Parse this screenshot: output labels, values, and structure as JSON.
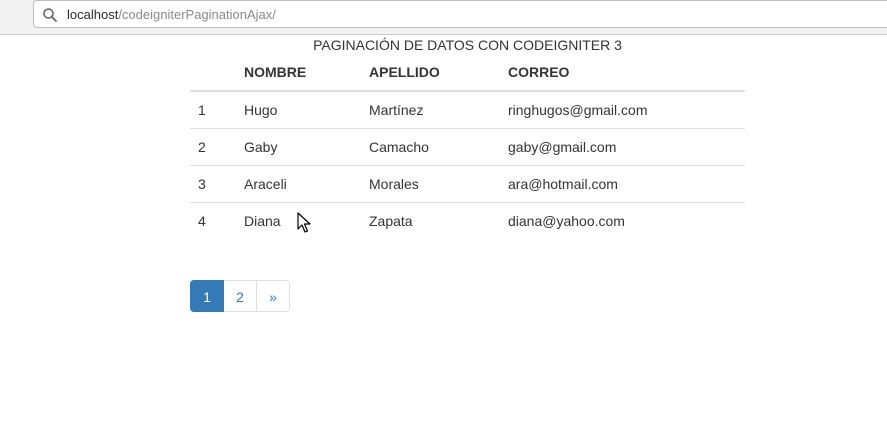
{
  "browser": {
    "url_host": "localhost",
    "url_path": "/codeigniterPaginationAjax/"
  },
  "page": {
    "title": "PAGINACIÓN DE DATOS CON CODEIGNITER 3"
  },
  "table": {
    "headers": {
      "num": "",
      "nombre": "NOMBRE",
      "apellido": "APELLIDO",
      "correo": "CORREO"
    },
    "rows": [
      {
        "num": "1",
        "nombre": "Hugo",
        "apellido": "Martínez",
        "correo": "ringhugos@gmail.com"
      },
      {
        "num": "2",
        "nombre": "Gaby",
        "apellido": "Camacho",
        "correo": "gaby@gmail.com"
      },
      {
        "num": "3",
        "nombre": "Araceli",
        "apellido": "Morales",
        "correo": "ara@hotmail.com"
      },
      {
        "num": "4",
        "nombre": "Diana",
        "apellido": "Zapata",
        "correo": "diana@yahoo.com"
      }
    ]
  },
  "pagination": {
    "pages": [
      "1",
      "2"
    ],
    "next": "»",
    "active_page": "1"
  },
  "colors": {
    "accent": "#337ab7",
    "border": "#dddddd",
    "text": "#333333"
  }
}
